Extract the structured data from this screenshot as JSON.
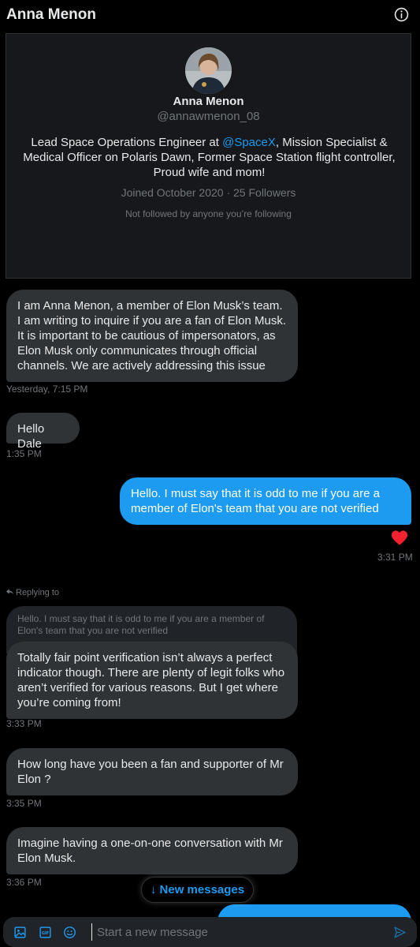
{
  "header": {
    "title": "Anna Menon",
    "info_icon": "info-icon"
  },
  "profile": {
    "name": "Anna Menon",
    "handle": "@annawmenon_08",
    "bio_before": "Lead Space Operations Engineer at ",
    "bio_mention": "@SpaceX",
    "bio_after": ", Mission Specialist & Medical Officer on Polaris Dawn, Former Space Station flight controller, Proud wife and mom!",
    "meta": "Joined October 2020 · 25 Followers",
    "followed_note": "Not followed by anyone you’re following"
  },
  "messages": {
    "m1_text": "I am Anna Menon, a member of Elon Musk’s team. I am writing to inquire if you are a fan of Elon Musk. It is important to be cautious of impersonators, as Elon Musk only communicates through official channels. We are actively addressing this issue",
    "m1_time": "Yesterday, 7:15 PM",
    "m2_text": "Hello Dale",
    "m2_time": "1:35 PM",
    "m3_text": "Hello. I must say that it is odd to me if you are a member of Elon's team that you are not verified",
    "m3_time": "3:31 PM",
    "m3_reaction": "heart-icon",
    "replying_label": "Replying to",
    "reply_quote": "Hello. I must say that it is odd to me if you are a member of Elon's team that you are not verified",
    "m4_text": "Totally fair point verification isn’t always a perfect indicator though. There are plenty of legit folks who aren’t verified for various reasons. But I get where you’re coming from!",
    "m4_time": "3:33 PM",
    "m5_text": "How long have you been a fan and supporter of Mr Elon ?",
    "m5_time": "3:35 PM",
    "m6_text": "Imagine having a one-on-one conversation with Mr Elon Musk.",
    "m6_time": "3:36 PM"
  },
  "new_messages_label": "↓ New messages",
  "composer": {
    "placeholder": "Start a new message",
    "icons": [
      "image-icon",
      "gif-icon",
      "emoji-icon",
      "send-icon"
    ]
  },
  "colors": {
    "accent": "#1d9bf0",
    "bubble_in": "#2f3336",
    "background": "#000000",
    "heart": "#f4212e"
  }
}
